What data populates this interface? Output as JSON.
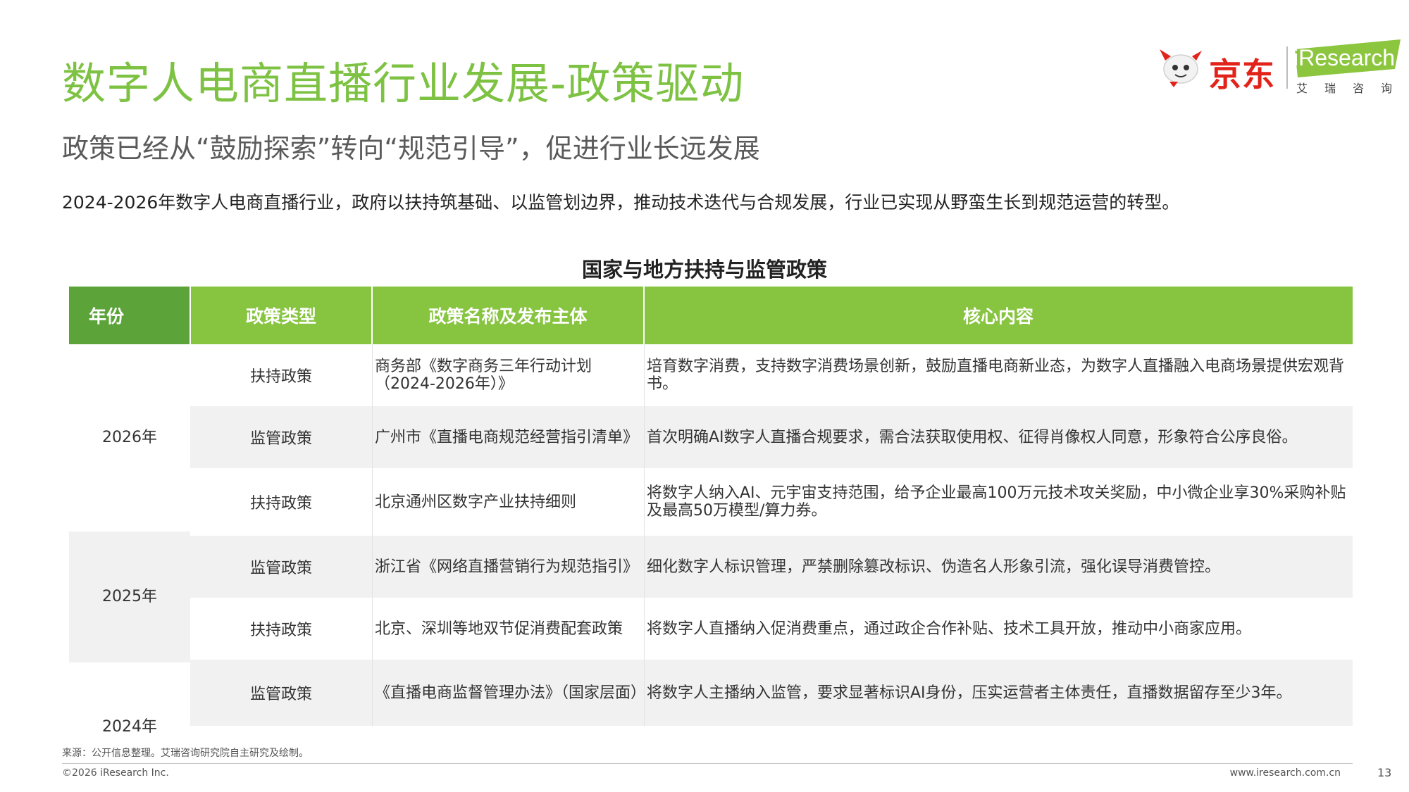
{
  "title": "数字人电商直播行业发展-政策驱动",
  "subtitle": "政策已经从“鼓励探索”转向“规范引导”，促进行业长远发展",
  "summary": "2024-2026年数字人电商直播行业，政府以扶持筑基础、以监管划边界，推动技术迭代与合规发展，行业已实现从野蛮生长到规范运营的转型。",
  "logos": {
    "jd_text": "京东",
    "iresearch_text": "iResearch",
    "iresearch_sub": "艾瑞咨询",
    "jd_color": "#e2231a",
    "iresearch_color": "#7dc242"
  },
  "table": {
    "title": "国家与地方扶持与监管政策",
    "headers": [
      "年份",
      "政策类型",
      "政策名称及发布主体",
      "核心内容"
    ],
    "header_color": "#87c440",
    "header_first_color": "#5ca43a",
    "years": [
      "2026年",
      "2025年",
      "2024年"
    ],
    "rows": [
      {
        "type": "扶持政策",
        "name": "商务部《数字商务三年行动计划（2024-2026年）》",
        "core": "培育数字消费，支持数字消费场景创新，鼓励直播电商新业态，为数字人直播融入电商场景提供宏观背书。"
      },
      {
        "type": "监管政策",
        "name": "广州市《直播电商规范经营指引清单》",
        "core": "首次明确AI数字人直播合规要求，需合法获取使用权、征得肖像权人同意，形象符合公序良俗。"
      },
      {
        "type": "扶持政策",
        "name": "北京通州区数字产业扶持细则",
        "core": "将数字人纳入AI、元宇宙支持范围，给予企业最高100万元技术攻关奖励，中小微企业享30%采购补贴及最高50万模型/算力券。"
      },
      {
        "type": "监管政策",
        "name": "浙江省《网络直播营销行为规范指引》",
        "core": "细化数字人标识管理，严禁删除篡改标识、伪造名人形象引流，强化误导消费管控。"
      },
      {
        "type": "扶持政策",
        "name": "北京、深圳等地双节促消费配套政策",
        "core": "将数字人直播纳入促消费重点，通过政企合作补贴、技术工具开放，推动中小商家应用。"
      },
      {
        "type": "监管政策",
        "name": "《直播电商监督管理办法》（国家层面）",
        "core": "将数字人主播纳入监管，要求显著标识AI身份，压实运营者主体责任，直播数据留存至少3年。"
      }
    ]
  },
  "footer": {
    "source": "来源：公开信息整理。艾瑞咨询研究院自主研究及绘制。",
    "copyright": "©2026 iResearch Inc.",
    "website": "www.iresearch.com.cn",
    "page": "13"
  }
}
